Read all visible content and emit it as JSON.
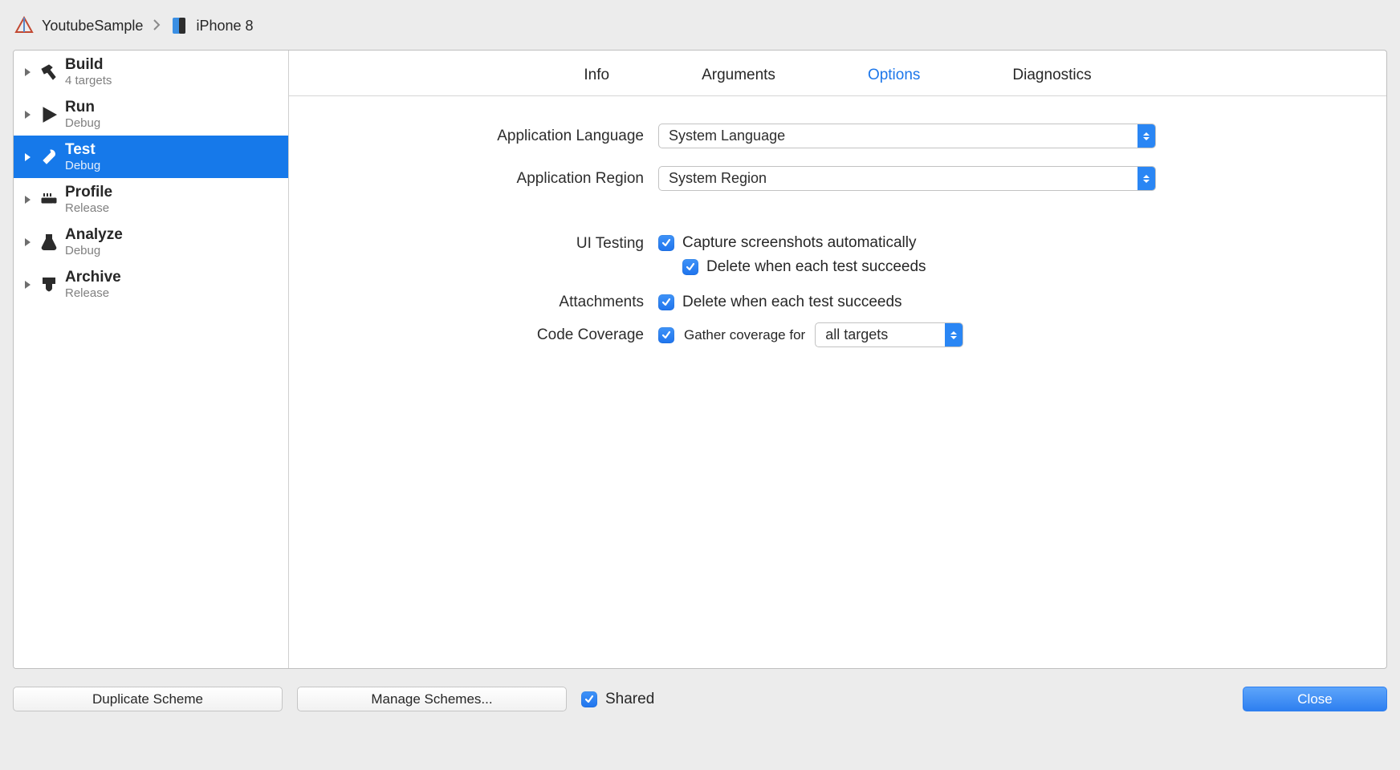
{
  "breadcrumb": {
    "scheme": "YoutubeSample",
    "device": "iPhone 8"
  },
  "sidebar": {
    "items": [
      {
        "title": "Build",
        "sub": "4 targets"
      },
      {
        "title": "Run",
        "sub": "Debug"
      },
      {
        "title": "Test",
        "sub": "Debug"
      },
      {
        "title": "Profile",
        "sub": "Release"
      },
      {
        "title": "Analyze",
        "sub": "Debug"
      },
      {
        "title": "Archive",
        "sub": "Release"
      }
    ]
  },
  "tabs": {
    "info": "Info",
    "arguments": "Arguments",
    "options": "Options",
    "diagnostics": "Diagnostics"
  },
  "form": {
    "appLanguage": {
      "label": "Application Language",
      "value": "System Language"
    },
    "appRegion": {
      "label": "Application Region",
      "value": "System Region"
    },
    "uiTesting": {
      "label": "UI Testing",
      "capture": "Capture screenshots automatically",
      "deleteSucceeds": "Delete when each test succeeds"
    },
    "attachments": {
      "label": "Attachments",
      "deleteSucceeds": "Delete when each test succeeds"
    },
    "codeCoverage": {
      "label": "Code Coverage",
      "gatherFor": "Gather coverage for",
      "targets": "all targets"
    }
  },
  "footer": {
    "duplicate": "Duplicate Scheme",
    "manage": "Manage Schemes...",
    "shared": "Shared",
    "close": "Close"
  }
}
